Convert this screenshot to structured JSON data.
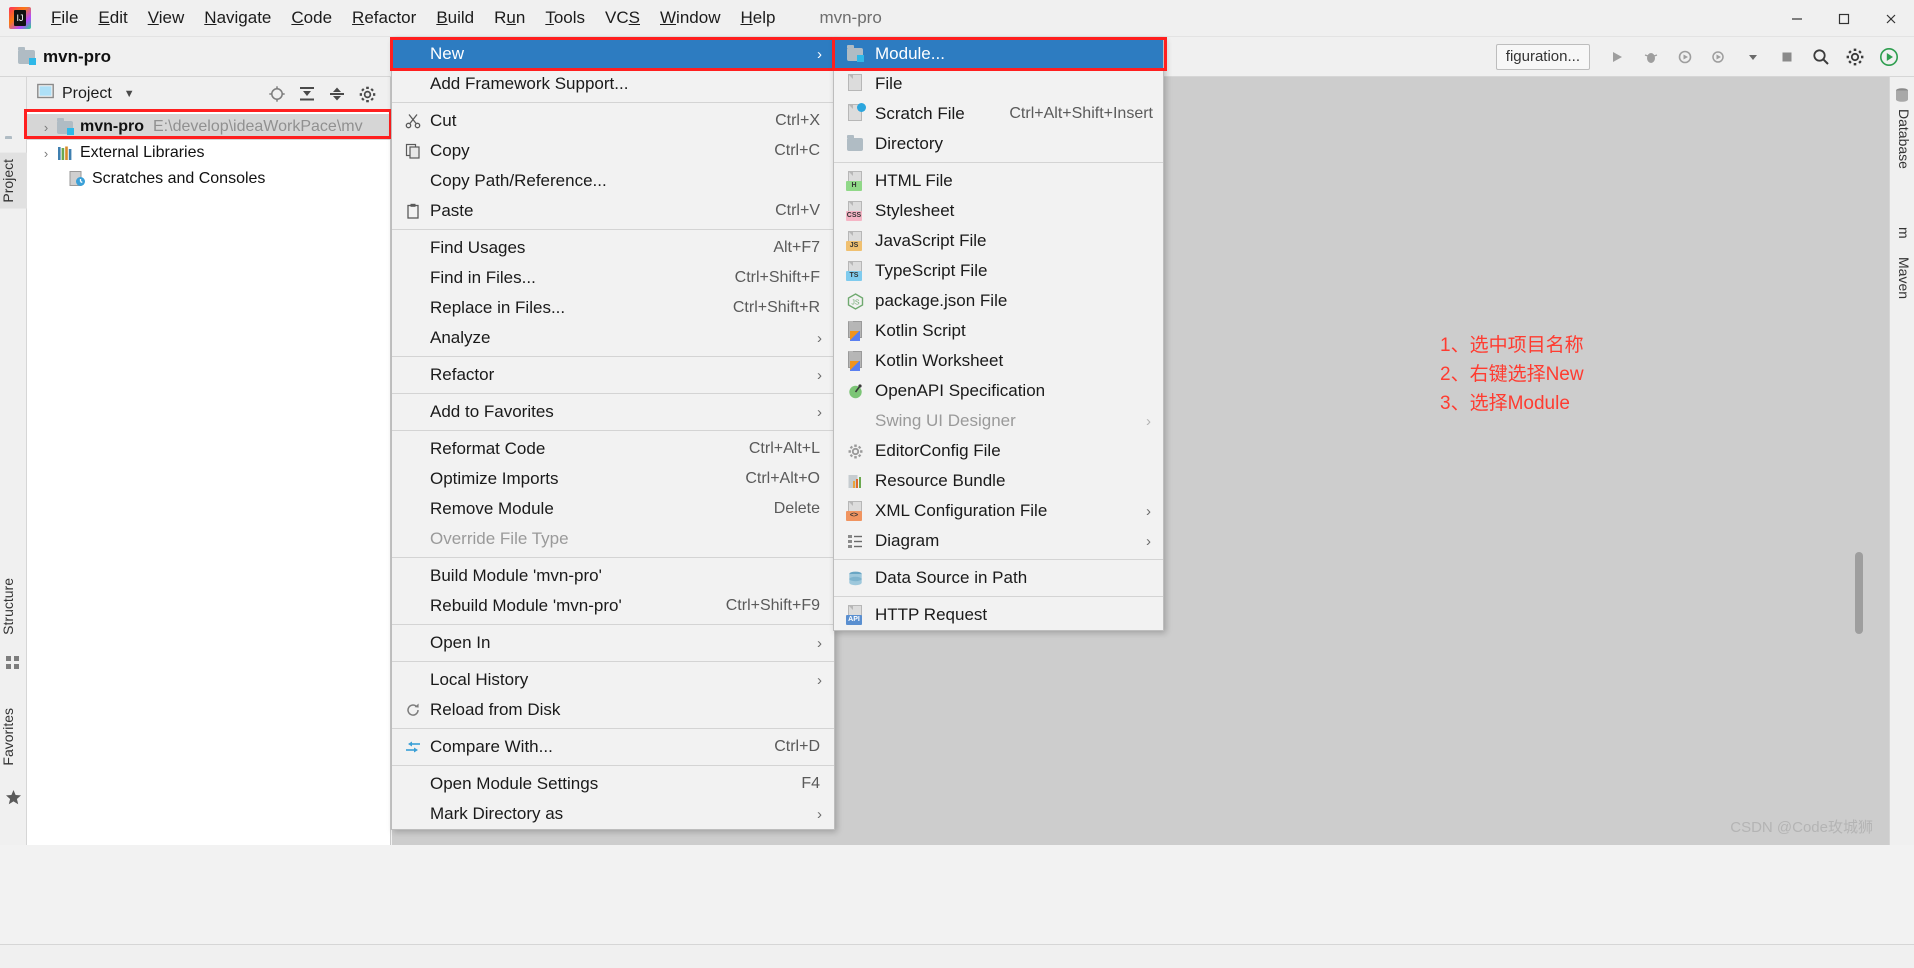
{
  "window": {
    "title": "mvn-pro",
    "minimize": "–",
    "maximize": "❑",
    "close": "✕"
  },
  "menubar": {
    "items": [
      {
        "label": "File",
        "mnemonic_index": 0
      },
      {
        "label": "Edit",
        "mnemonic_index": 0
      },
      {
        "label": "View",
        "mnemonic_index": 0
      },
      {
        "label": "Navigate",
        "mnemonic_index": 0
      },
      {
        "label": "Code",
        "mnemonic_index": 0
      },
      {
        "label": "Refactor",
        "mnemonic_index": 0
      },
      {
        "label": "Build",
        "mnemonic_index": 0
      },
      {
        "label": "Run",
        "mnemonic_index": 1
      },
      {
        "label": "Tools",
        "mnemonic_index": 0
      },
      {
        "label": "VCS",
        "mnemonic_index": 2
      },
      {
        "label": "Window",
        "mnemonic_index": 0
      },
      {
        "label": "Help",
        "mnemonic_index": 0
      }
    ]
  },
  "toolbar": {
    "project_name": "mvn-pro",
    "run_config": "figuration...",
    "icons": [
      "folder-icon",
      "run-icon",
      "debug-icon",
      "coverage-icon",
      "profile-icon",
      "dropdown-icon",
      "stop-icon",
      "search-icon",
      "settings-icon",
      "run-anything-icon"
    ]
  },
  "left_strip": {
    "project_tab": "Project",
    "structure_tab": "Structure",
    "favorites_tab": "Favorites"
  },
  "right_strip": {
    "database_tab": "Database",
    "maven_tab": "Maven",
    "m_label": "m"
  },
  "project_panel": {
    "title": "Project",
    "caret": "▼",
    "header_icons": [
      "locate-icon",
      "expand-all-icon",
      "collapse-all-icon",
      "settings-icon"
    ],
    "tree": [
      {
        "arrow": "›",
        "label": "mvn-pro",
        "path": "E:\\develop\\ideaWorkPace\\mv",
        "icon": "module-folder-icon",
        "selected": true,
        "bold": true
      },
      {
        "arrow": "›",
        "label": "External Libraries",
        "path": "",
        "icon": "library-icon",
        "selected": false,
        "bold": false
      },
      {
        "arrow": "",
        "label": "Scratches and Consoles",
        "path": "",
        "icon": "scratches-icon",
        "selected": false,
        "bold": false
      }
    ]
  },
  "context_menu": {
    "items": [
      {
        "label": "New",
        "accel": "",
        "arrow": "›",
        "icon": "",
        "highlight": true,
        "disabled": false
      },
      {
        "label": "Add Framework Support...",
        "accel": "",
        "arrow": "",
        "icon": "",
        "highlight": false,
        "disabled": false
      },
      {
        "separator": true
      },
      {
        "label": "Cut",
        "accel": "Ctrl+X",
        "arrow": "",
        "icon": "cut-icon",
        "highlight": false,
        "disabled": false
      },
      {
        "label": "Copy",
        "accel": "Ctrl+C",
        "arrow": "",
        "icon": "copy-icon",
        "highlight": false,
        "disabled": false
      },
      {
        "label": "Copy Path/Reference...",
        "accel": "",
        "arrow": "",
        "icon": "",
        "highlight": false,
        "disabled": false
      },
      {
        "label": "Paste",
        "accel": "Ctrl+V",
        "arrow": "",
        "icon": "paste-icon",
        "highlight": false,
        "disabled": false
      },
      {
        "separator": true
      },
      {
        "label": "Find Usages",
        "accel": "Alt+F7",
        "arrow": "",
        "icon": "",
        "highlight": false,
        "disabled": false
      },
      {
        "label": "Find in Files...",
        "accel": "Ctrl+Shift+F",
        "arrow": "",
        "icon": "",
        "highlight": false,
        "disabled": false
      },
      {
        "label": "Replace in Files...",
        "accel": "Ctrl+Shift+R",
        "arrow": "",
        "icon": "",
        "highlight": false,
        "disabled": false
      },
      {
        "label": "Analyze",
        "accel": "",
        "arrow": "›",
        "icon": "",
        "highlight": false,
        "disabled": false
      },
      {
        "separator": true
      },
      {
        "label": "Refactor",
        "accel": "",
        "arrow": "›",
        "icon": "",
        "highlight": false,
        "disabled": false
      },
      {
        "separator": true
      },
      {
        "label": "Add to Favorites",
        "accel": "",
        "arrow": "›",
        "icon": "",
        "highlight": false,
        "disabled": false
      },
      {
        "separator": true
      },
      {
        "label": "Reformat Code",
        "accel": "Ctrl+Alt+L",
        "arrow": "",
        "icon": "",
        "highlight": false,
        "disabled": false
      },
      {
        "label": "Optimize Imports",
        "accel": "Ctrl+Alt+O",
        "arrow": "",
        "icon": "",
        "highlight": false,
        "disabled": false
      },
      {
        "label": "Remove Module",
        "accel": "Delete",
        "arrow": "",
        "icon": "",
        "highlight": false,
        "disabled": false
      },
      {
        "label": "Override File Type",
        "accel": "",
        "arrow": "",
        "icon": "",
        "highlight": false,
        "disabled": true
      },
      {
        "separator": true
      },
      {
        "label": "Build Module 'mvn-pro'",
        "accel": "",
        "arrow": "",
        "icon": "",
        "highlight": false,
        "disabled": false
      },
      {
        "label": "Rebuild Module 'mvn-pro'",
        "accel": "Ctrl+Shift+F9",
        "arrow": "",
        "icon": "",
        "highlight": false,
        "disabled": false
      },
      {
        "separator": true
      },
      {
        "label": "Open In",
        "accel": "",
        "arrow": "›",
        "icon": "",
        "highlight": false,
        "disabled": false
      },
      {
        "separator": true
      },
      {
        "label": "Local History",
        "accel": "",
        "arrow": "›",
        "icon": "",
        "highlight": false,
        "disabled": false
      },
      {
        "label": "Reload from Disk",
        "accel": "",
        "arrow": "",
        "icon": "reload-icon",
        "highlight": false,
        "disabled": false
      },
      {
        "separator": true
      },
      {
        "label": "Compare With...",
        "accel": "Ctrl+D",
        "arrow": "",
        "icon": "compare-icon",
        "highlight": false,
        "disabled": false
      },
      {
        "separator": true
      },
      {
        "label": "Open Module Settings",
        "accel": "F4",
        "arrow": "",
        "icon": "",
        "highlight": false,
        "disabled": false
      },
      {
        "label": "Mark Directory as",
        "accel": "",
        "arrow": "›",
        "icon": "",
        "highlight": false,
        "disabled": false
      }
    ]
  },
  "submenu": {
    "items": [
      {
        "label": "Module...",
        "accel": "",
        "arrow": "",
        "icon": "module-icon",
        "highlight": true,
        "disabled": false
      },
      {
        "label": "File",
        "accel": "",
        "arrow": "",
        "icon": "file-icon",
        "highlight": false,
        "disabled": false
      },
      {
        "label": "Scratch File",
        "accel": "Ctrl+Alt+Shift+Insert",
        "arrow": "",
        "icon": "scratch-file-icon",
        "highlight": false,
        "disabled": false
      },
      {
        "label": "Directory",
        "accel": "",
        "arrow": "",
        "icon": "directory-icon",
        "highlight": false,
        "disabled": false
      },
      {
        "separator": true
      },
      {
        "label": "HTML File",
        "accel": "",
        "arrow": "",
        "icon": "html-file-icon",
        "highlight": false,
        "disabled": false
      },
      {
        "label": "Stylesheet",
        "accel": "",
        "arrow": "",
        "icon": "css-file-icon",
        "highlight": false,
        "disabled": false
      },
      {
        "label": "JavaScript File",
        "accel": "",
        "arrow": "",
        "icon": "js-file-icon",
        "highlight": false,
        "disabled": false
      },
      {
        "label": "TypeScript File",
        "accel": "",
        "arrow": "",
        "icon": "ts-file-icon",
        "highlight": false,
        "disabled": false
      },
      {
        "label": "package.json File",
        "accel": "",
        "arrow": "",
        "icon": "nodejs-icon",
        "highlight": false,
        "disabled": false
      },
      {
        "label": "Kotlin Script",
        "accel": "",
        "arrow": "",
        "icon": "kotlin-icon",
        "highlight": false,
        "disabled": false
      },
      {
        "label": "Kotlin Worksheet",
        "accel": "",
        "arrow": "",
        "icon": "kotlin-icon",
        "highlight": false,
        "disabled": false
      },
      {
        "label": "OpenAPI Specification",
        "accel": "",
        "arrow": "",
        "icon": "openapi-icon",
        "highlight": false,
        "disabled": false
      },
      {
        "label": "Swing UI Designer",
        "accel": "",
        "arrow": "›",
        "icon": "",
        "highlight": false,
        "disabled": true
      },
      {
        "label": "EditorConfig File",
        "accel": "",
        "arrow": "",
        "icon": "editorconfig-icon",
        "highlight": false,
        "disabled": false
      },
      {
        "label": "Resource Bundle",
        "accel": "",
        "arrow": "",
        "icon": "resource-bundle-icon",
        "highlight": false,
        "disabled": false
      },
      {
        "label": "XML Configuration File",
        "accel": "",
        "arrow": "›",
        "icon": "xml-file-icon",
        "highlight": false,
        "disabled": false
      },
      {
        "label": "Diagram",
        "accel": "",
        "arrow": "›",
        "icon": "diagram-icon",
        "highlight": false,
        "disabled": false
      },
      {
        "separator": true
      },
      {
        "label": "Data Source in Path",
        "accel": "",
        "arrow": "",
        "icon": "datasource-icon",
        "highlight": false,
        "disabled": false
      },
      {
        "separator": true
      },
      {
        "label": "HTTP Request",
        "accel": "",
        "arrow": "",
        "icon": "http-request-icon",
        "highlight": false,
        "disabled": false
      }
    ]
  },
  "annotations": {
    "lines": [
      "1、选中项目名称",
      "2、右键选择New",
      "3、选择Module"
    ],
    "color": "#ff3b30"
  },
  "watermark": "CSDN @Code玫城狮",
  "colors": {
    "highlight_blue": "#2d7cc1",
    "redbox": "#ff1f1f",
    "menu_bg": "#f2f2f2",
    "editor_bg": "#cdcdcd"
  }
}
